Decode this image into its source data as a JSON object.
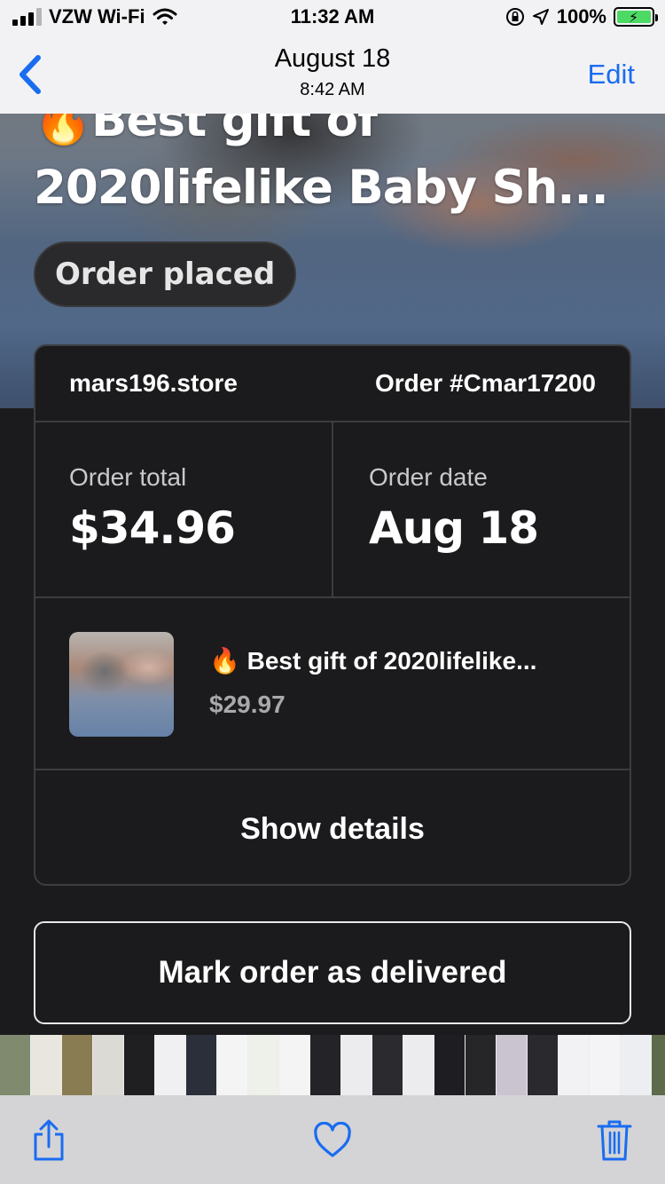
{
  "status_bar": {
    "carrier": "VZW Wi-Fi",
    "time": "11:32 AM",
    "battery": "100%",
    "icons": [
      "signal-icon",
      "wifi-icon",
      "orientation-lock-icon",
      "location-icon",
      "battery-charging-icon"
    ]
  },
  "nav": {
    "title": "August 18",
    "subtitle": "8:42 AM",
    "edit_label": "Edit",
    "back_icon": "chevron-left-icon"
  },
  "hero": {
    "title_line1": "🔥Best gift of",
    "title_line2": "2020lifelike Baby Sh...",
    "status": "Order placed"
  },
  "order": {
    "store": "mars196.store",
    "order_number": "Order #Cmar17200",
    "total_label": "Order total",
    "total_value": "$34.96",
    "date_label": "Order date",
    "date_value": "Aug 18",
    "item_title": "🔥 Best gift of 2020lifelike...",
    "item_price": "$29.97",
    "details_label": "Show details"
  },
  "actions": {
    "mark_delivered_label": "Mark order as delivered"
  },
  "toolbar": {
    "icons": [
      "share-icon",
      "heart-icon",
      "trash-icon"
    ]
  },
  "colors": {
    "accent": "#1a6cf0",
    "background": "#1b1b1d",
    "border": "#3d3d40",
    "nav_bg": "#f2f2f4",
    "toolbar_bg": "#d4d4d6",
    "battery": "#4cd964"
  }
}
